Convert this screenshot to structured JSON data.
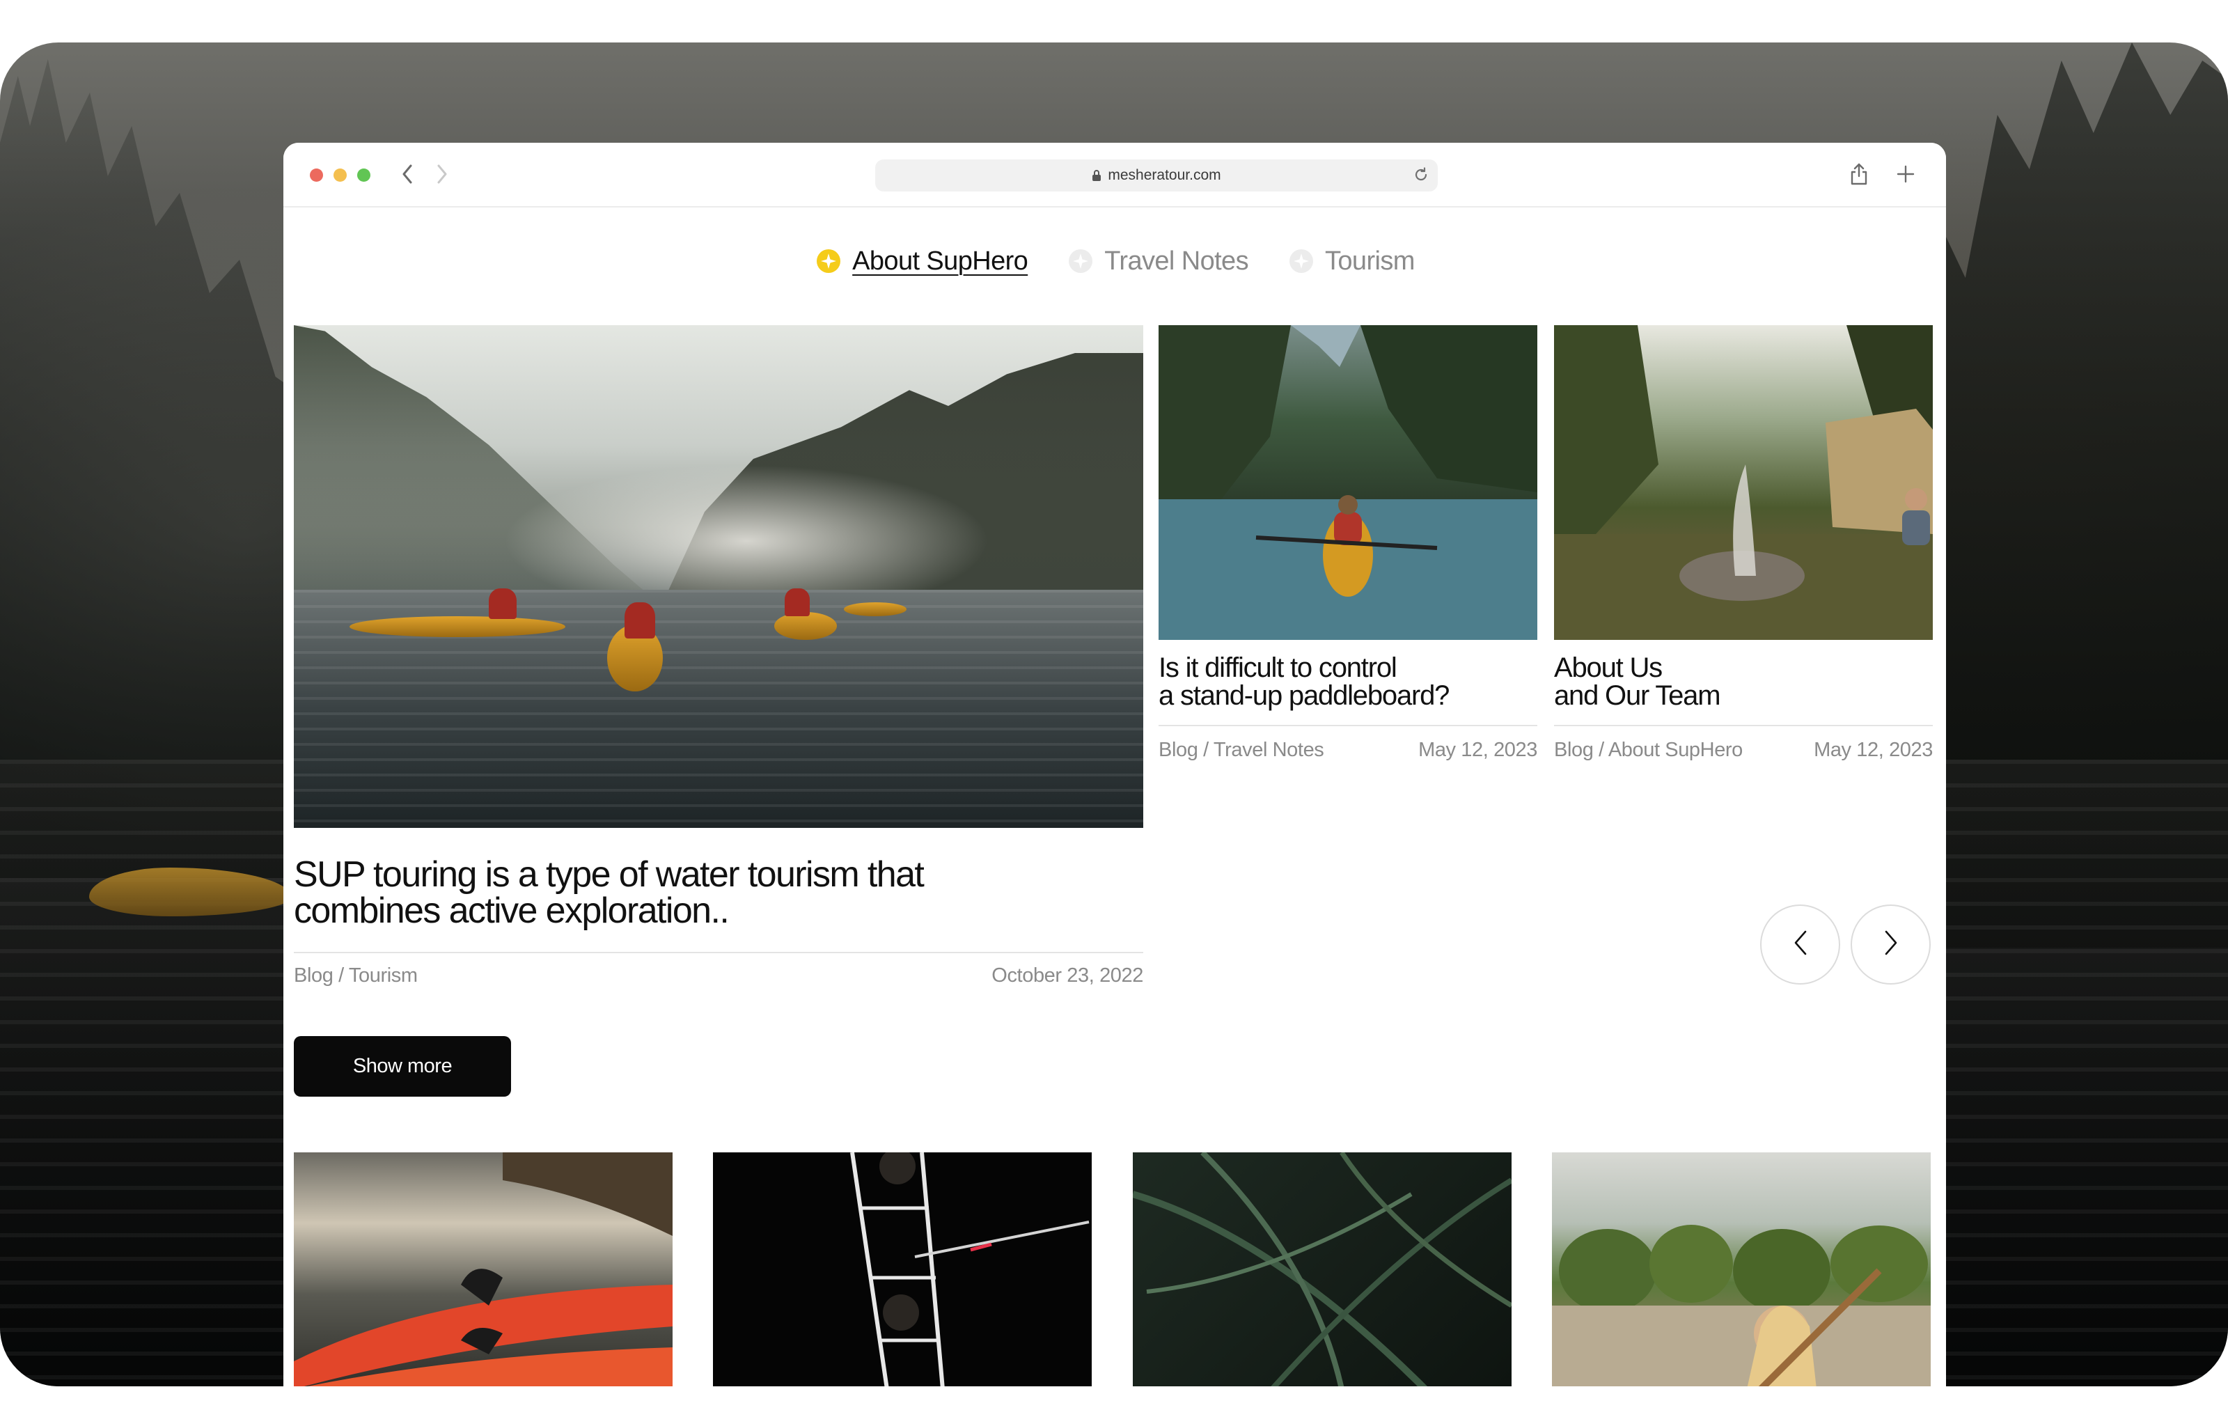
{
  "browser": {
    "url": "mesheratour.com"
  },
  "categories": [
    {
      "label": "About SupHero",
      "active": true
    },
    {
      "label": "Travel Notes",
      "active": false
    },
    {
      "label": "Tourism",
      "active": false
    }
  ],
  "feature": {
    "title_line1": "SUP touring is a type of water tourism that",
    "title_line2": "combines active exploration..",
    "category": "Blog / Tourism",
    "date": "October 23, 2022",
    "show_more": "Show more"
  },
  "cards": [
    {
      "title_line1": "Is it difficult to control",
      "title_line2": "a stand-up paddleboard?",
      "category": "Blog / Travel Notes",
      "date": "May 12, 2023"
    },
    {
      "title_line1": "About Us",
      "title_line2": "and Our Team",
      "category": "Blog / About SupHero",
      "date": "May 12, 2023"
    }
  ],
  "colors": {
    "accent_active_dot": "#f5cc1a",
    "button_bg": "#0a0a0a",
    "muted_text": "#8a8a8a"
  },
  "icons": {
    "back": "chevron-left-icon",
    "forward": "chevron-right-icon",
    "lock": "lock-icon",
    "reload": "reload-icon",
    "share": "share-icon",
    "new_tab": "plus-icon",
    "carousel_prev": "chevron-left-icon",
    "carousel_next": "chevron-right-icon"
  }
}
